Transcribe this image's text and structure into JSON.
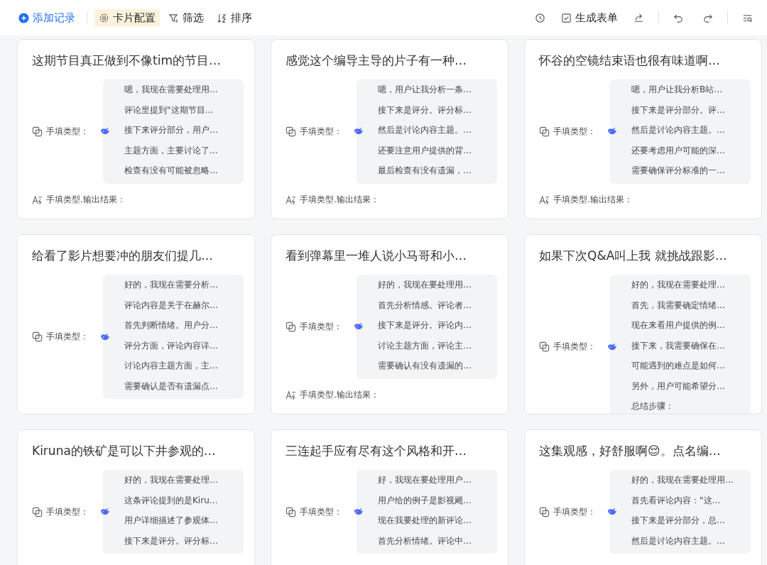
{
  "toolbar": {
    "add_button": "添加记录",
    "tools": [
      {
        "label": "卡片配置",
        "kind": "settings",
        "selected": true
      },
      {
        "label": "筛选",
        "kind": "filter",
        "selected": false
      },
      {
        "label": "排序",
        "kind": "sort",
        "selected": false
      }
    ],
    "form_button": "生成表单"
  },
  "cards": [
    {
      "title": "这期节目真正做到不像tim的节目…",
      "field_label": "手填类型：",
      "reasoning": [
        "嗯，我现在需要处理用…",
        "评论里提到\"这期节目…",
        "接下来评分部分，用户…",
        "主题方面，主要讨论了…",
        "检查有没有可能被忽略…"
      ],
      "output_label": "手填类型.输出结果："
    },
    {
      "title": "感觉这个编导主导的片子有一种…",
      "field_label": "手填类型：",
      "reasoning": [
        "嗯，用户让我分析一条…",
        "接下来是评分。评分标…",
        "然后是讨论内容主题。…",
        "还要注意用户提供的背…",
        "最后检查有没有遗漏，…"
      ],
      "output_label": "手填类型.输出结果："
    },
    {
      "title": "怀谷的空镜结束语也很有味道啊…",
      "field_label": "手填类型：",
      "reasoning": [
        "嗯，用户让我分析B站…",
        "接下来是评分部分。评…",
        "然后是讨论内容主题。…",
        "还要考虑用户可能的深…",
        "需要确保评分标准的一…"
      ],
      "output_label": "手填类型.输出结果："
    },
    {
      "title": "给看了影片想要冲的朋友们提几…",
      "field_label": "手填类型：",
      "reasoning": [
        "好的，我现在需要分析…",
        "评论内容是关于在赫尔…",
        "首先判断情绪。用户分…",
        "评分方面，评论内容详…",
        "讨论内容主题方面，主…",
        "需要确认是否有遗漏点…"
      ]
    },
    {
      "title": "看到弹幕里一堆人说小马哥和小…",
      "field_label": "手填类型：",
      "reasoning": [
        "好的，我现在要处理用…",
        "首先分析情感。评论者…",
        "接下来是评分。评论内…",
        "讨论主题方面，评论主…",
        "需要确认有没有遗漏的…"
      ],
      "output_label": "手填类型.输出结果："
    },
    {
      "title": "如果下次Q&A叫上我 就挑战跟影…",
      "field_label": "手填类型：",
      "reasoning": [
        "好的，我现在需要处理…",
        "首先，我需要确定情绪…",
        "现在来看用户提供的例…",
        "接下来，我需要确保在…",
        "可能遇到的难点是如何…",
        "另外，用户可能希望分…",
        "总结步骤："
      ]
    },
    {
      "title": "Kiruna的铁矿是可以下井参观的…",
      "field_label": "手填类型：",
      "reasoning": [
        "好的，我现在需要处理…",
        "这条评论提到的是Kiru…",
        "用户详细描述了参观体…",
        "接下来是评分。评分标…"
      ]
    },
    {
      "title": "三连起手应有尽有这个风格和开…",
      "field_label": "手填类型：",
      "reasoning": [
        "好，我现在要处理用户…",
        "用户给的例子是影视飓…",
        "现在我要处理的新评论…",
        "首先分析情绪。评论中…"
      ]
    },
    {
      "title": "这集观感，好舒服啊😌。点名编…",
      "field_label": "手填类型：",
      "reasoning": [
        "好的，我现在需要处理用…",
        "首先看评论内容：\"这…",
        "接下来是评分部分，总…",
        "然后是讨论内容主题。…"
      ]
    }
  ]
}
